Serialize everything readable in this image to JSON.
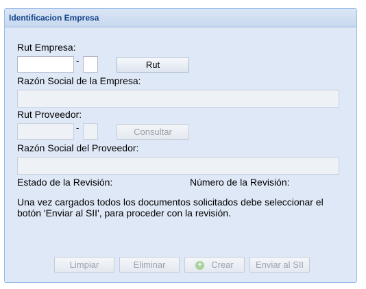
{
  "panel": {
    "title": "Identificacion Empresa"
  },
  "form": {
    "rut_empresa_label": "Rut Empresa:",
    "rut_empresa_value": "",
    "rut_empresa_dv_value": "",
    "dash": "-",
    "rut_button_label": "Rut",
    "razon_social_empresa_label": "Razón Social de la Empresa:",
    "razon_social_empresa_value": "",
    "rut_proveedor_label": "Rut Proveedor:",
    "rut_proveedor_value": "",
    "rut_proveedor_dv_value": "",
    "consultar_button_label": "Consultar",
    "razon_social_proveedor_label": "Razón Social del Proveedor:",
    "razon_social_proveedor_value": "",
    "estado_revision_label": "Estado de la Revisión:",
    "numero_revision_label": "Número de la Revisión:",
    "instructions": "Una vez cargados todos los documentos solicitados debe seleccionar el botón 'Enviar al SII', para proceder con la revisión."
  },
  "actions": {
    "limpiar": "Limpiar",
    "eliminar": "Eliminar",
    "crear": "Crear",
    "enviar": "Enviar al SII"
  },
  "icons": {
    "crear_icon": "plus-circle-icon"
  },
  "colors": {
    "header_text": "#15428b",
    "panel_bg": "#dfe8f6",
    "border": "#99bbe8"
  }
}
